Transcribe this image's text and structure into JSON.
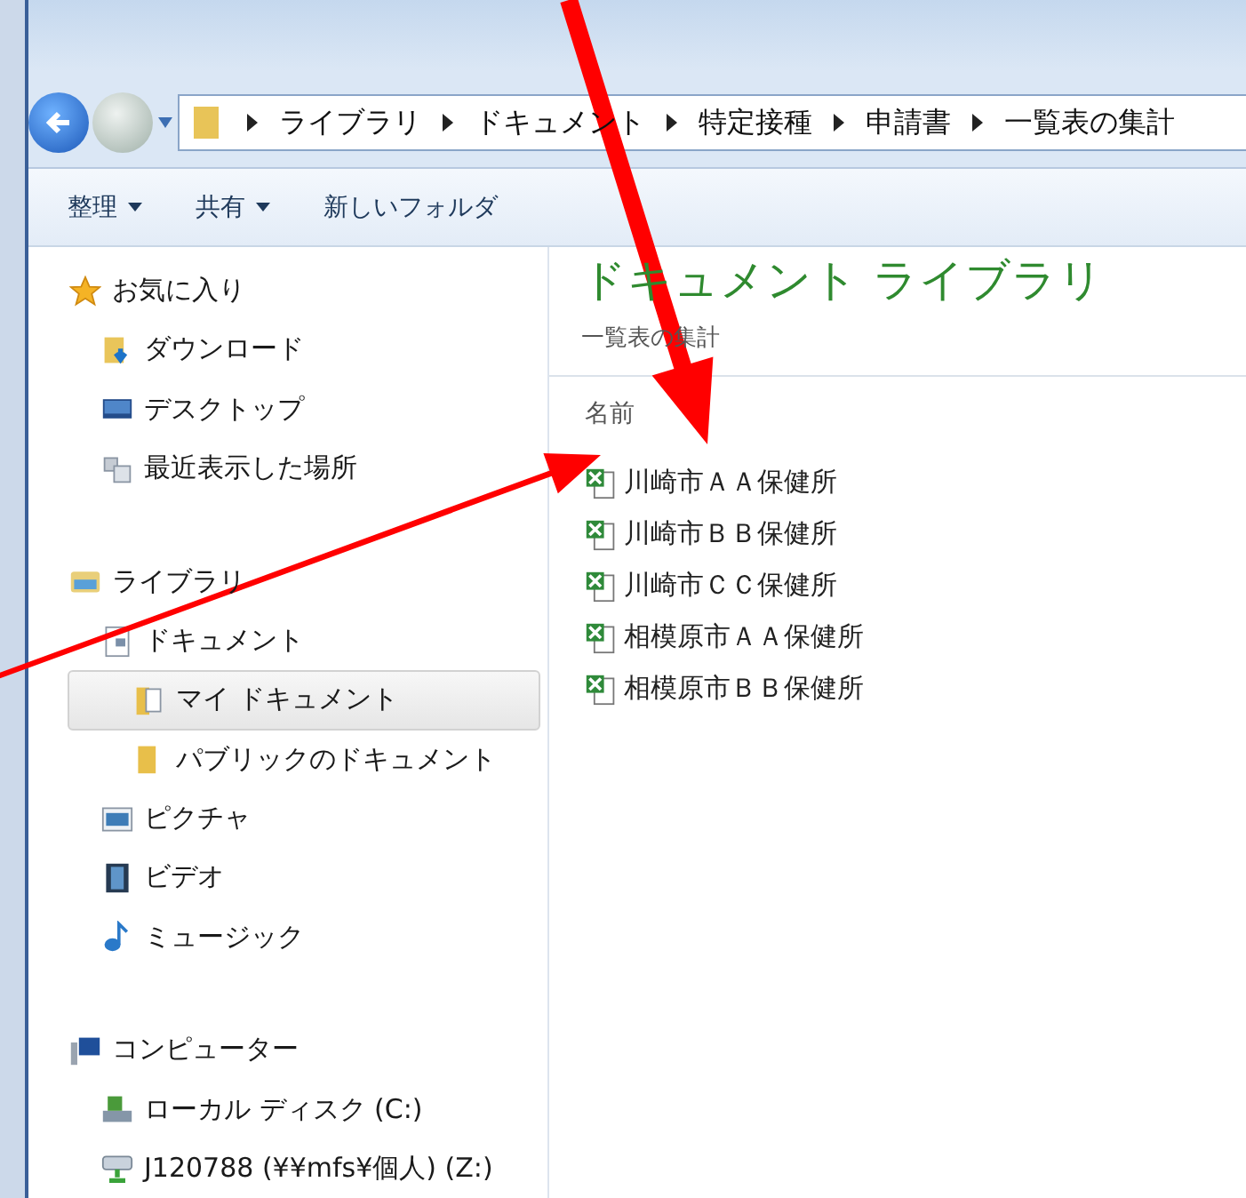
{
  "address_bar": {
    "segments": [
      "ライブラリ",
      "ドキュメント",
      "特定接種",
      "申請書",
      "一覧表の集計"
    ]
  },
  "toolbar": [
    {
      "label": "整理",
      "dropdown": true
    },
    {
      "label": "共有",
      "dropdown": true
    },
    {
      "label": "新しいフォルダ",
      "dropdown": false
    }
  ],
  "sidebar": {
    "groups": [
      {
        "label": "お気に入り",
        "kind": "star",
        "children": [
          {
            "label": "ダウンロード",
            "kind": "download",
            "selected": false
          },
          {
            "label": "デスクトップ",
            "kind": "desktop",
            "selected": false
          },
          {
            "label": "最近表示した場所",
            "kind": "recent",
            "selected": false
          }
        ]
      },
      {
        "label": "ライブラリ",
        "kind": "library",
        "children": [
          {
            "label": "ドキュメント",
            "kind": "document",
            "selected": false,
            "children": [
              {
                "label": "マイ ドキュメント",
                "kind": "folder-doc",
                "selected": true
              },
              {
                "label": "パブリックのドキュメント",
                "kind": "folder",
                "selected": false
              }
            ]
          },
          {
            "label": "ピクチャ",
            "kind": "picture-lib",
            "selected": false
          },
          {
            "label": "ビデオ",
            "kind": "video",
            "selected": false
          },
          {
            "label": "ミュージック",
            "kind": "music",
            "selected": false
          }
        ]
      },
      {
        "label": "コンピューター",
        "kind": "computer",
        "children": [
          {
            "label": "ローカル ディスク (C:)",
            "kind": "disk",
            "selected": false
          },
          {
            "label": "J120788 (¥¥mfs¥個人) (Z:)",
            "kind": "network",
            "selected": false
          }
        ]
      }
    ]
  },
  "content": {
    "title": "ドキュメント ライブラリ",
    "subtitle": "一覧表の集計",
    "column": "名前",
    "files": [
      "川崎市ＡＡ保健所",
      "川崎市ＢＢ保健所",
      "川崎市ＣＣ保健所",
      "相模原市ＡＡ保健所",
      "相模原市ＢＢ保健所"
    ]
  }
}
